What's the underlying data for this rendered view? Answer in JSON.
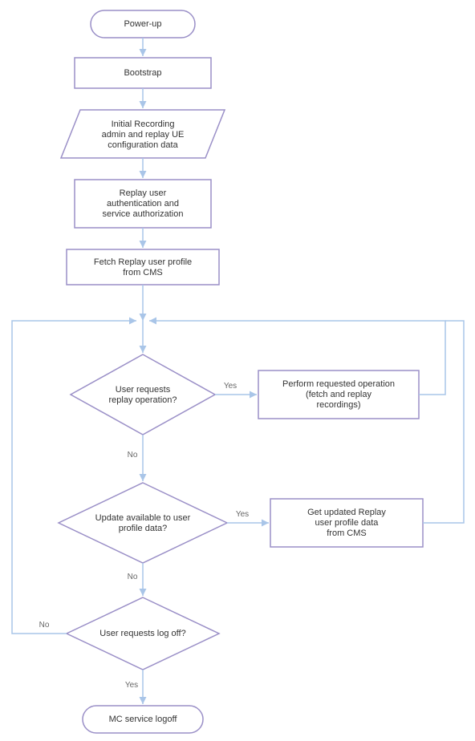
{
  "chart_data": {
    "type": "flowchart",
    "nodes": [
      {
        "id": "n1",
        "shape": "terminator",
        "label": [
          "Power-up"
        ]
      },
      {
        "id": "n2",
        "shape": "process",
        "label": [
          "Bootstrap"
        ]
      },
      {
        "id": "n3",
        "shape": "data",
        "label": [
          "Initial Recording",
          "admin and replay UE",
          "configuration data"
        ]
      },
      {
        "id": "n4",
        "shape": "process",
        "label": [
          "Replay user",
          "authentication and",
          "service authorization"
        ]
      },
      {
        "id": "n5",
        "shape": "process",
        "label": [
          "Fetch Replay user profile",
          "from CMS"
        ]
      },
      {
        "id": "n6",
        "shape": "decision",
        "label": [
          "User requests",
          "replay operation?"
        ]
      },
      {
        "id": "n7",
        "shape": "process",
        "label": [
          "Perform requested operation",
          "(fetch and replay",
          "recordings)"
        ]
      },
      {
        "id": "n8",
        "shape": "decision",
        "label": [
          "Update available to user",
          "profile data?"
        ]
      },
      {
        "id": "n9",
        "shape": "process",
        "label": [
          "Get updated Replay",
          "user profile data",
          "from CMS"
        ]
      },
      {
        "id": "n10",
        "shape": "decision",
        "label": [
          "User requests log off?"
        ]
      },
      {
        "id": "n11",
        "shape": "terminator",
        "label": [
          "MC service logoff"
        ]
      }
    ],
    "edges": [
      {
        "from": "n1",
        "to": "n2"
      },
      {
        "from": "n2",
        "to": "n3"
      },
      {
        "from": "n3",
        "to": "n4"
      },
      {
        "from": "n4",
        "to": "n5"
      },
      {
        "from": "n5",
        "to": "merge"
      },
      {
        "from": "merge",
        "to": "n6"
      },
      {
        "from": "n6",
        "to": "n7",
        "label": "Yes"
      },
      {
        "from": "n6",
        "to": "n8",
        "label": "No"
      },
      {
        "from": "n7",
        "to": "merge"
      },
      {
        "from": "n8",
        "to": "n9",
        "label": "Yes"
      },
      {
        "from": "n8",
        "to": "n10",
        "label": "No"
      },
      {
        "from": "n9",
        "to": "merge"
      },
      {
        "from": "n10",
        "to": "merge",
        "label": "No"
      },
      {
        "from": "n10",
        "to": "n11",
        "label": "Yes"
      }
    ]
  },
  "labels": {
    "yes": "Yes",
    "no": "No"
  },
  "colors": {
    "node_stroke": "#9a8fc7",
    "node_fill": "#ffffff",
    "arrow": "#a9c5e8",
    "text": "#333333"
  }
}
